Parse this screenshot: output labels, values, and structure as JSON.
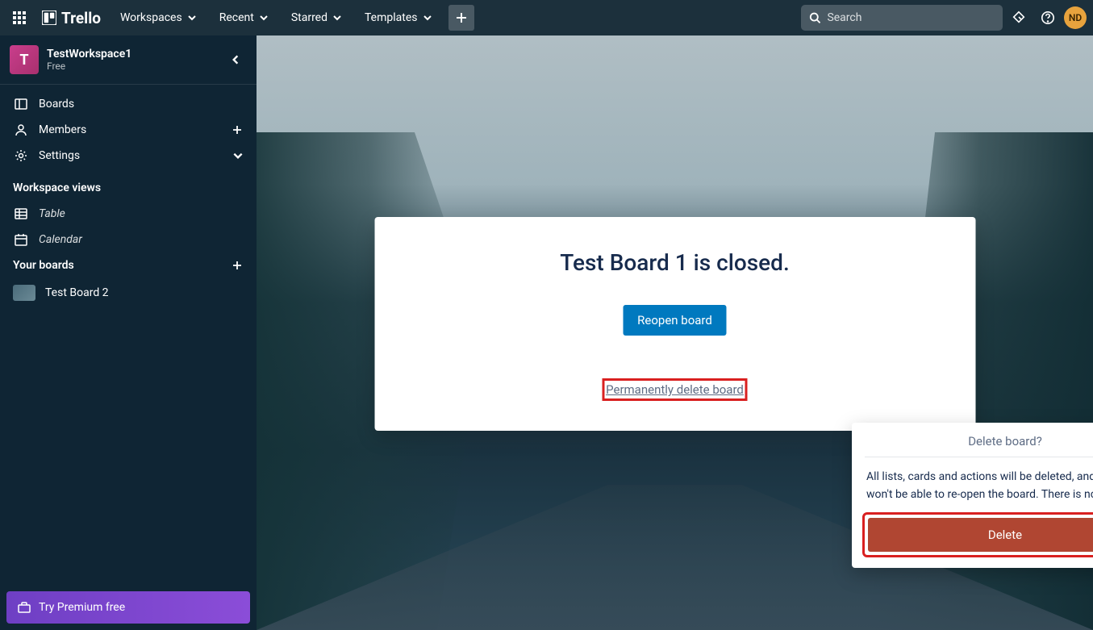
{
  "header": {
    "brand": "Trello",
    "nav": [
      "Workspaces",
      "Recent",
      "Starred",
      "Templates"
    ],
    "search_placeholder": "Search",
    "avatar_initials": "ND"
  },
  "sidebar": {
    "workspace": {
      "initial": "T",
      "name": "TestWorkspace1",
      "plan": "Free"
    },
    "main_items": [
      {
        "label": "Boards"
      },
      {
        "label": "Members"
      },
      {
        "label": "Settings"
      }
    ],
    "views_heading": "Workspace views",
    "views": [
      {
        "label": "Table"
      },
      {
        "label": "Calendar"
      }
    ],
    "boards_heading": "Your boards",
    "boards": [
      {
        "label": "Test Board 2"
      }
    ],
    "premium_label": "Try Premium free"
  },
  "dialog": {
    "title": "Test Board 1 is closed.",
    "reopen_label": "Reopen board",
    "delete_link_label": "Permanently delete board"
  },
  "popover": {
    "title": "Delete board?",
    "body": "All lists, cards and actions will be deleted, and you won't be able to re-open the board. There is no undo.",
    "delete_label": "Delete"
  }
}
